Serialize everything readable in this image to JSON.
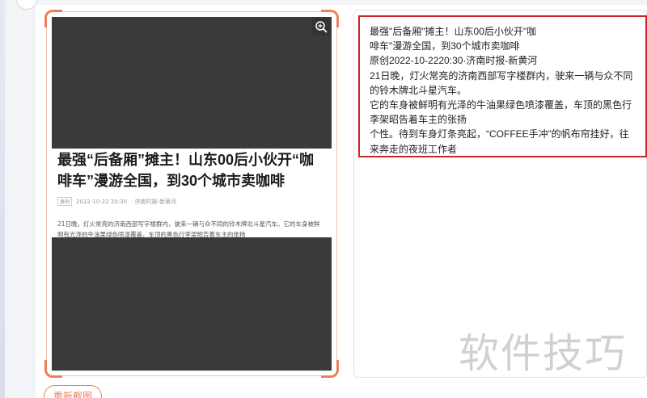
{
  "article": {
    "title": "最强“后备厢”摊主！山东00后小伙开“咖啡车”漫游全国，到30个城市卖咖啡",
    "meta_badge": "原创",
    "meta_date": "2022-10-22 20:30",
    "meta_source": "· 济南时报-新黄河",
    "body": "21日晚，灯火常亮的济南西部写字楼群内，驶来一辆与众不同的铃木牌北斗星汽车。它的车身被鲜明有光泽的牛油果绿色喷漆覆盖，车顶的黑色行李架昭告着车主的张扬"
  },
  "result": {
    "lines": [
      "最强\"后备厢\"摊主！山东00后小伙开\"咖",
      "啡车\"漫游全国，到30个城市卖咖啡",
      "原创2022-10-2220:30·济南时报-新黄河",
      "21日晚，灯火常亮的济南西部写字楼群内，驶来一辆与众不同",
      "的铃木牌北斗星汽车。",
      "它的车身被鲜明有光泽的牛油果绿色喷漆覆盖，车顶的黑色行",
      "李架昭告着车主的张扬",
      "个性。待到车身灯条亮起，“COFFEE手冲”的帆布帘挂好，往",
      "来奔走的夜班工作者"
    ]
  },
  "watermark": "软件技巧",
  "recapture_label": "重新截图",
  "icons": {
    "zoom": "zoom-in-icon"
  },
  "colors": {
    "accent": "#e8825e",
    "highlight": "#c9252b",
    "image_bg": "#3a393b"
  }
}
